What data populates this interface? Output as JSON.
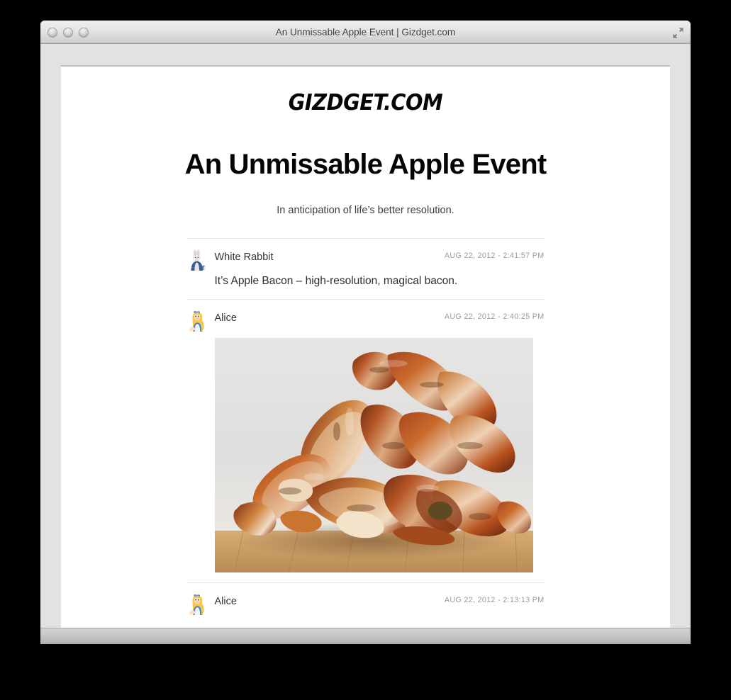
{
  "window": {
    "title": "An Unmissable Apple Event | Gizdget.com",
    "traffic_lights": [
      "close",
      "minimize",
      "zoom"
    ],
    "fullscreen_icon": "fullscreen-arrows-icon"
  },
  "site": {
    "logo_text": "GIZDGET.COM"
  },
  "article": {
    "headline": "An Unmissable Apple Event",
    "subhead": "In anticipation of life’s better resolution."
  },
  "comments": [
    {
      "author": "White Rabbit",
      "avatar": "white-rabbit-avatar",
      "timestamp": "AUG 22, 2012 - 2:41:57 PM",
      "body": "It’s Apple Bacon – high-resolution, magical bacon.",
      "photo": null
    },
    {
      "author": "Alice",
      "avatar": "alice-avatar",
      "timestamp": "AUG 22, 2012 - 2:40:25 PM",
      "body": null,
      "photo": "pile-of-cooked-bacon-on-wooden-board"
    },
    {
      "author": "Alice",
      "avatar": "alice-avatar",
      "timestamp": "AUG 22, 2012 - 2:13:13 PM",
      "body": null,
      "photo": null
    }
  ],
  "colors": {
    "desktop": "#000000",
    "window_chrome": "#e2e2e2",
    "page_background": "#ffffff",
    "title_text": "#3b3b3b",
    "timestamp_text": "#9b9b9b",
    "rule": "#e4e4e4"
  }
}
